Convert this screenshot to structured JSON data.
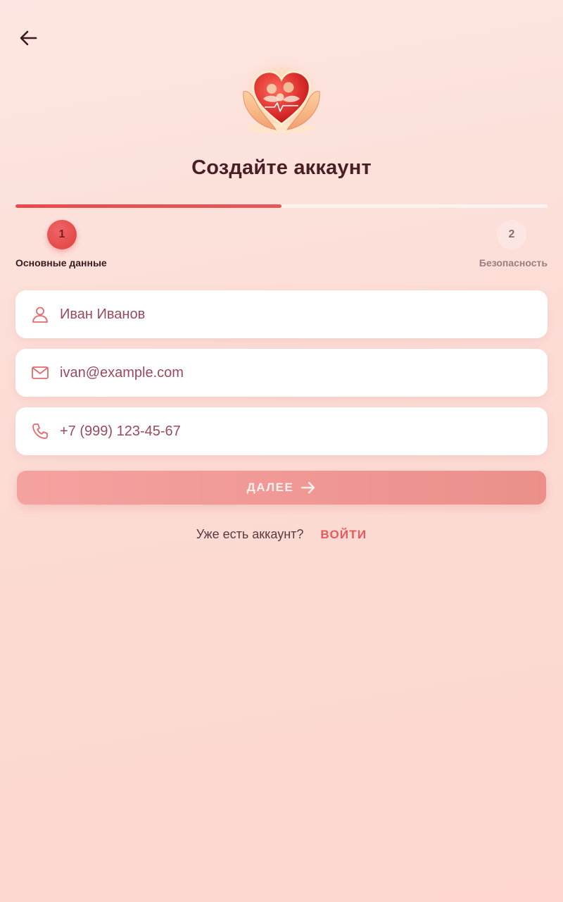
{
  "header": {
    "back_icon": "arrow-left-icon",
    "logo_icon": "heart-hands-family-logo"
  },
  "title": "Создайте аккаунт",
  "progress": {
    "value": 0.5,
    "color": "#e84a4d"
  },
  "steps": [
    {
      "number": "1",
      "label": "Основные данные",
      "state": "active"
    },
    {
      "number": "2",
      "label": "Безопасность",
      "state": "inactive"
    }
  ],
  "form": {
    "name": {
      "icon": "user-icon",
      "value": "Иван Иванов"
    },
    "email": {
      "icon": "mail-icon",
      "value": "ivan@example.com"
    },
    "phone": {
      "icon": "phone-icon",
      "value": "+7 (999) 123-45-67"
    }
  },
  "next_button": {
    "label": "ДАЛЕЕ",
    "icon": "arrow-right-icon"
  },
  "login": {
    "prompt": "Уже есть аккаунт?",
    "link_label": "ВОЙТИ"
  },
  "colors": {
    "accent": "#e84a4d",
    "title": "#4a1e25",
    "field_text": "#9a4a5a",
    "button": "#f09a96"
  }
}
